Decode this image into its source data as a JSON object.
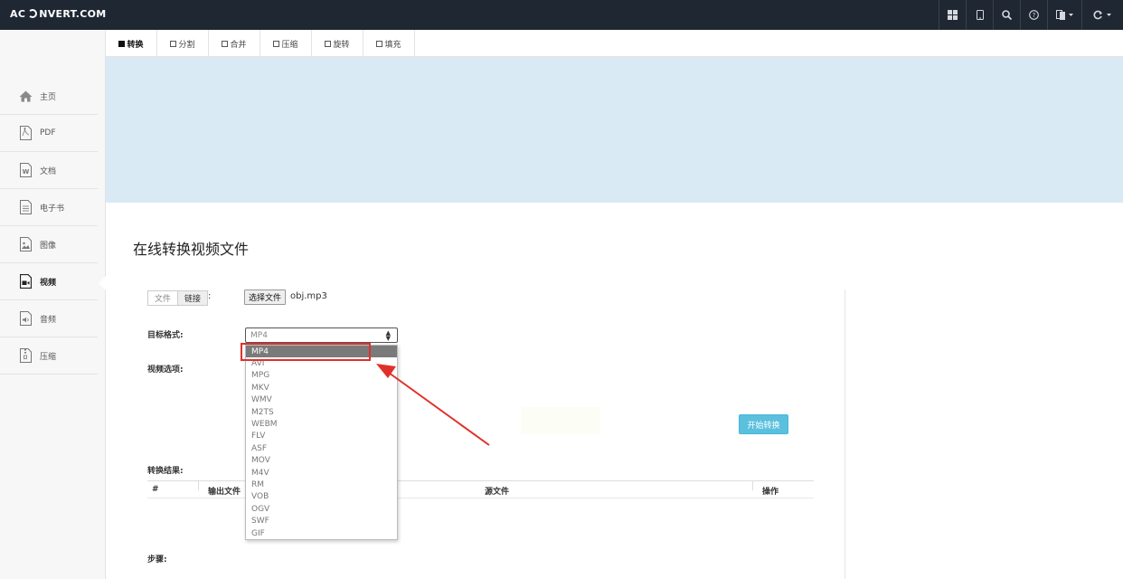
{
  "brand": {
    "left": "AC",
    "right": "NVERT.COM"
  },
  "topnav": {
    "icons": [
      "grid-icon",
      "tablet-icon",
      "search-icon",
      "help-icon",
      "language-icon",
      "refresh-icon"
    ]
  },
  "sidebar": {
    "items": [
      {
        "label": "主页",
        "icon": "home-icon"
      },
      {
        "label": "PDF",
        "icon": "pdf-file-icon"
      },
      {
        "label": "文档",
        "icon": "word-file-icon"
      },
      {
        "label": "电子书",
        "icon": "ebook-file-icon"
      },
      {
        "label": "图像",
        "icon": "image-file-icon"
      },
      {
        "label": "视频",
        "icon": "video-file-icon",
        "active": true
      },
      {
        "label": "音频",
        "icon": "audio-file-icon"
      },
      {
        "label": "压缩",
        "icon": "archive-file-icon"
      }
    ]
  },
  "tabs": [
    {
      "label": "转换",
      "active": true
    },
    {
      "label": "分割"
    },
    {
      "label": "合并"
    },
    {
      "label": "压缩"
    },
    {
      "label": "旋转"
    },
    {
      "label": "填充"
    }
  ],
  "main": {
    "title": "在线转换视频文件",
    "source_toggle": {
      "file": "文件",
      "link": "链接",
      "colon": ":"
    },
    "file_button": "选择文件",
    "file_name": "obj.mp3",
    "target_format_label": "目标格式:",
    "target_format_value": "MP4",
    "format_options": [
      "MP4",
      "AVI",
      "MPG",
      "MKV",
      "WMV",
      "M2TS",
      "WEBM",
      "FLV",
      "ASF",
      "MOV",
      "M4V",
      "RM",
      "VOB",
      "OGV",
      "SWF",
      "GIF"
    ],
    "video_options_label": "视频选项:",
    "start_button": "开始转换",
    "results_label": "转换结果:",
    "table_headers": [
      "#",
      "输出文件",
      "源文件",
      "操作"
    ],
    "steps_label": "步骤:"
  },
  "colors": {
    "topbar": "#1f2733",
    "banner": "#d9eaf5",
    "start_button": "#5bc0de",
    "annotation": "#e0302a"
  }
}
